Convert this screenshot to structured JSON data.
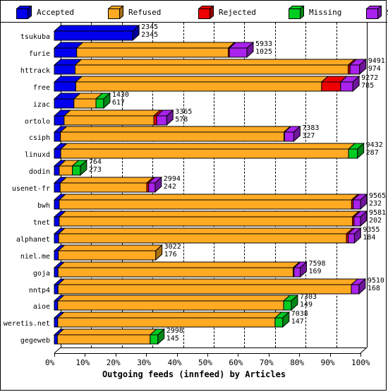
{
  "legend": {
    "items": [
      {
        "label": "Accepted",
        "color": "#0000ee",
        "icon": "cube-icon"
      },
      {
        "label": "Refused",
        "color": "#ffaa22",
        "icon": "cube-icon"
      },
      {
        "label": "Rejected",
        "color": "#ee0000",
        "icon": "cube-icon"
      },
      {
        "label": "Missing",
        "color": "#00cc22",
        "icon": "cube-icon"
      },
      {
        "label": "Spooled",
        "color": "#aa22ee",
        "icon": "cube-icon"
      }
    ]
  },
  "axis": {
    "x_title": "Outgoing feeds (innfeed) by Articles",
    "x_ticks": [
      "0%",
      "10%",
      "20%",
      "30%",
      "40%",
      "50%",
      "60%",
      "70%",
      "80%",
      "90%",
      "100%"
    ]
  },
  "chart_data": {
    "type": "bar",
    "orientation": "horizontal",
    "stacked": true,
    "normalized": true,
    "title": "Outgoing feeds (innfeed) by Articles",
    "xlabel": "Outgoing feeds (innfeed) by Articles",
    "ylabel": "",
    "xlim": [
      0,
      100
    ],
    "xtick_labels": [
      "0%",
      "10%",
      "20%",
      "30%",
      "40%",
      "50%",
      "60%",
      "70%",
      "80%",
      "90%",
      "100%"
    ],
    "grid": true,
    "legend_position": "top",
    "series": [
      {
        "name": "Accepted",
        "color": "#0000ee"
      },
      {
        "name": "Refused",
        "color": "#ffaa22"
      },
      {
        "name": "Rejected",
        "color": "#ee0000"
      },
      {
        "name": "Missing",
        "color": "#00cc22"
      },
      {
        "name": "Spooled",
        "color": "#aa22ee"
      }
    ],
    "categories": [
      "tsukuba",
      "furie",
      "httrack",
      "free",
      "izac",
      "ortolo",
      "csiph",
      "linuxd",
      "dodin",
      "usenet-fr",
      "bwh",
      "tnet",
      "alphanet",
      "niel.me",
      "goja",
      "nntp4",
      "aioe",
      "weretis.net",
      "gegeweb"
    ],
    "rows": [
      {
        "category": "tsukuba",
        "label_top": "2345",
        "label_bottom": "2345",
        "total_pct": 25.6,
        "parts": [
          {
            "s": "Accepted",
            "pct": 25.6
          },
          {
            "s": "Refused",
            "pct": 0
          },
          {
            "s": "Rejected",
            "pct": 0
          },
          {
            "s": "Missing",
            "pct": 0
          },
          {
            "s": "Spooled",
            "pct": 0
          }
        ]
      },
      {
        "category": "furie",
        "label_top": "5933",
        "label_bottom": "1025",
        "total_pct": 62.9,
        "parts": [
          {
            "s": "Accepted",
            "pct": 7.3
          },
          {
            "s": "Refused",
            "pct": 49.5
          },
          {
            "s": "Rejected",
            "pct": 0.4
          },
          {
            "s": "Missing",
            "pct": 0
          },
          {
            "s": "Spooled",
            "pct": 5.7
          }
        ]
      },
      {
        "category": "httrack",
        "label_top": "9491",
        "label_bottom": "974",
        "total_pct": 99.7,
        "parts": [
          {
            "s": "Accepted",
            "pct": 6.8
          },
          {
            "s": "Refused",
            "pct": 89.2
          },
          {
            "s": "Rejected",
            "pct": 0.6
          },
          {
            "s": "Missing",
            "pct": 0
          },
          {
            "s": "Spooled",
            "pct": 3.1
          }
        ]
      },
      {
        "category": "free",
        "label_top": "9272",
        "label_bottom": "785",
        "total_pct": 97.5,
        "parts": [
          {
            "s": "Accepted",
            "pct": 7.0
          },
          {
            "s": "Refused",
            "pct": 80.3
          },
          {
            "s": "Rejected",
            "pct": 6.2
          },
          {
            "s": "Missing",
            "pct": 0
          },
          {
            "s": "Spooled",
            "pct": 4.0
          }
        ]
      },
      {
        "category": "izac",
        "label_top": "1430",
        "label_bottom": "617",
        "total_pct": 16.1,
        "parts": [
          {
            "s": "Accepted",
            "pct": 6.4
          },
          {
            "s": "Refused",
            "pct": 7.2
          },
          {
            "s": "Rejected",
            "pct": 0
          },
          {
            "s": "Missing",
            "pct": 2.5
          },
          {
            "s": "Spooled",
            "pct": 0
          }
        ]
      },
      {
        "category": "ortolo",
        "label_top": "3365",
        "label_bottom": "578",
        "total_pct": 36.7,
        "parts": [
          {
            "s": "Accepted",
            "pct": 3.2
          },
          {
            "s": "Refused",
            "pct": 29.3
          },
          {
            "s": "Rejected",
            "pct": 0.9
          },
          {
            "s": "Missing",
            "pct": 0
          },
          {
            "s": "Spooled",
            "pct": 3.3
          }
        ]
      },
      {
        "category": "csiph",
        "label_top": "7383",
        "label_bottom": "327",
        "total_pct": 78.2,
        "parts": [
          {
            "s": "Accepted",
            "pct": 2.0
          },
          {
            "s": "Refused",
            "pct": 73.0
          },
          {
            "s": "Rejected",
            "pct": 0.2
          },
          {
            "s": "Missing",
            "pct": 0
          },
          {
            "s": "Spooled",
            "pct": 3.0
          }
        ]
      },
      {
        "category": "linuxd",
        "label_top": "9432",
        "label_bottom": "287",
        "total_pct": 99.0,
        "parts": [
          {
            "s": "Accepted",
            "pct": 2.1
          },
          {
            "s": "Refused",
            "pct": 94.0
          },
          {
            "s": "Rejected",
            "pct": 0
          },
          {
            "s": "Missing",
            "pct": 2.9
          },
          {
            "s": "Spooled",
            "pct": 0
          }
        ]
      },
      {
        "category": "dodin",
        "label_top": "764",
        "label_bottom": "273",
        "total_pct": 8.5,
        "parts": [
          {
            "s": "Accepted",
            "pct": 1.6
          },
          {
            "s": "Refused",
            "pct": 4.3
          },
          {
            "s": "Rejected",
            "pct": 0
          },
          {
            "s": "Missing",
            "pct": 2.6
          },
          {
            "s": "Spooled",
            "pct": 0
          }
        ]
      },
      {
        "category": "usenet-fr",
        "label_top": "2994",
        "label_bottom": "242",
        "total_pct": 32.9,
        "parts": [
          {
            "s": "Accepted",
            "pct": 1.9
          },
          {
            "s": "Refused",
            "pct": 28.3
          },
          {
            "s": "Rejected",
            "pct": 0.6
          },
          {
            "s": "Missing",
            "pct": 0
          },
          {
            "s": "Spooled",
            "pct": 2.1
          }
        ]
      },
      {
        "category": "bwh",
        "label_top": "9565",
        "label_bottom": "232",
        "total_pct": 100.0,
        "parts": [
          {
            "s": "Accepted",
            "pct": 1.6
          },
          {
            "s": "Refused",
            "pct": 95.5
          },
          {
            "s": "Rejected",
            "pct": 0.5
          },
          {
            "s": "Missing",
            "pct": 0
          },
          {
            "s": "Spooled",
            "pct": 2.4
          }
        ]
      },
      {
        "category": "tnet",
        "label_top": "9581",
        "label_bottom": "202",
        "total_pct": 100.0,
        "parts": [
          {
            "s": "Accepted",
            "pct": 1.6
          },
          {
            "s": "Refused",
            "pct": 95.8
          },
          {
            "s": "Rejected",
            "pct": 0.5
          },
          {
            "s": "Missing",
            "pct": 0
          },
          {
            "s": "Spooled",
            "pct": 2.1
          }
        ]
      },
      {
        "category": "alphanet",
        "label_top": "9355",
        "label_bottom": "184",
        "total_pct": 98.0,
        "parts": [
          {
            "s": "Accepted",
            "pct": 1.4
          },
          {
            "s": "Refused",
            "pct": 94.0
          },
          {
            "s": "Rejected",
            "pct": 0.6
          },
          {
            "s": "Missing",
            "pct": 0
          },
          {
            "s": "Spooled",
            "pct": 2.0
          }
        ]
      },
      {
        "category": "niel.me",
        "label_top": "3022",
        "label_bottom": "176",
        "total_pct": 33.1,
        "parts": [
          {
            "s": "Accepted",
            "pct": 1.3
          },
          {
            "s": "Refused",
            "pct": 31.8
          },
          {
            "s": "Rejected",
            "pct": 0
          },
          {
            "s": "Missing",
            "pct": 0
          },
          {
            "s": "Spooled",
            "pct": 0
          }
        ]
      },
      {
        "category": "goja",
        "label_top": "7598",
        "label_bottom": "169",
        "total_pct": 80.3,
        "parts": [
          {
            "s": "Accepted",
            "pct": 1.2
          },
          {
            "s": "Refused",
            "pct": 76.8
          },
          {
            "s": "Rejected",
            "pct": 0.3
          },
          {
            "s": "Missing",
            "pct": 0
          },
          {
            "s": "Spooled",
            "pct": 2.0
          }
        ]
      },
      {
        "category": "nntp4",
        "label_top": "9510",
        "label_bottom": "168",
        "total_pct": 99.5,
        "parts": [
          {
            "s": "Accepted",
            "pct": 1.2
          },
          {
            "s": "Refused",
            "pct": 95.8
          },
          {
            "s": "Rejected",
            "pct": 0
          },
          {
            "s": "Missing",
            "pct": 0
          },
          {
            "s": "Spooled",
            "pct": 2.5
          }
        ]
      },
      {
        "category": "aioe",
        "label_top": "7303",
        "label_bottom": "149",
        "total_pct": 77.4,
        "parts": [
          {
            "s": "Accepted",
            "pct": 1.1
          },
          {
            "s": "Refused",
            "pct": 73.8
          },
          {
            "s": "Rejected",
            "pct": 0
          },
          {
            "s": "Missing",
            "pct": 2.5
          },
          {
            "s": "Spooled",
            "pct": 0
          }
        ]
      },
      {
        "category": "weretis.net",
        "label_top": "7038",
        "label_bottom": "147",
        "total_pct": 74.6,
        "parts": [
          {
            "s": "Accepted",
            "pct": 1.1
          },
          {
            "s": "Refused",
            "pct": 71.0
          },
          {
            "s": "Rejected",
            "pct": 0
          },
          {
            "s": "Missing",
            "pct": 2.5
          },
          {
            "s": "Spooled",
            "pct": 0
          }
        ]
      },
      {
        "category": "gegeweb",
        "label_top": "2998",
        "label_bottom": "145",
        "total_pct": 33.8,
        "parts": [
          {
            "s": "Accepted",
            "pct": 1.0
          },
          {
            "s": "Refused",
            "pct": 30.3
          },
          {
            "s": "Rejected",
            "pct": 0
          },
          {
            "s": "Missing",
            "pct": 2.5
          },
          {
            "s": "Spooled",
            "pct": 0
          }
        ]
      }
    ]
  }
}
